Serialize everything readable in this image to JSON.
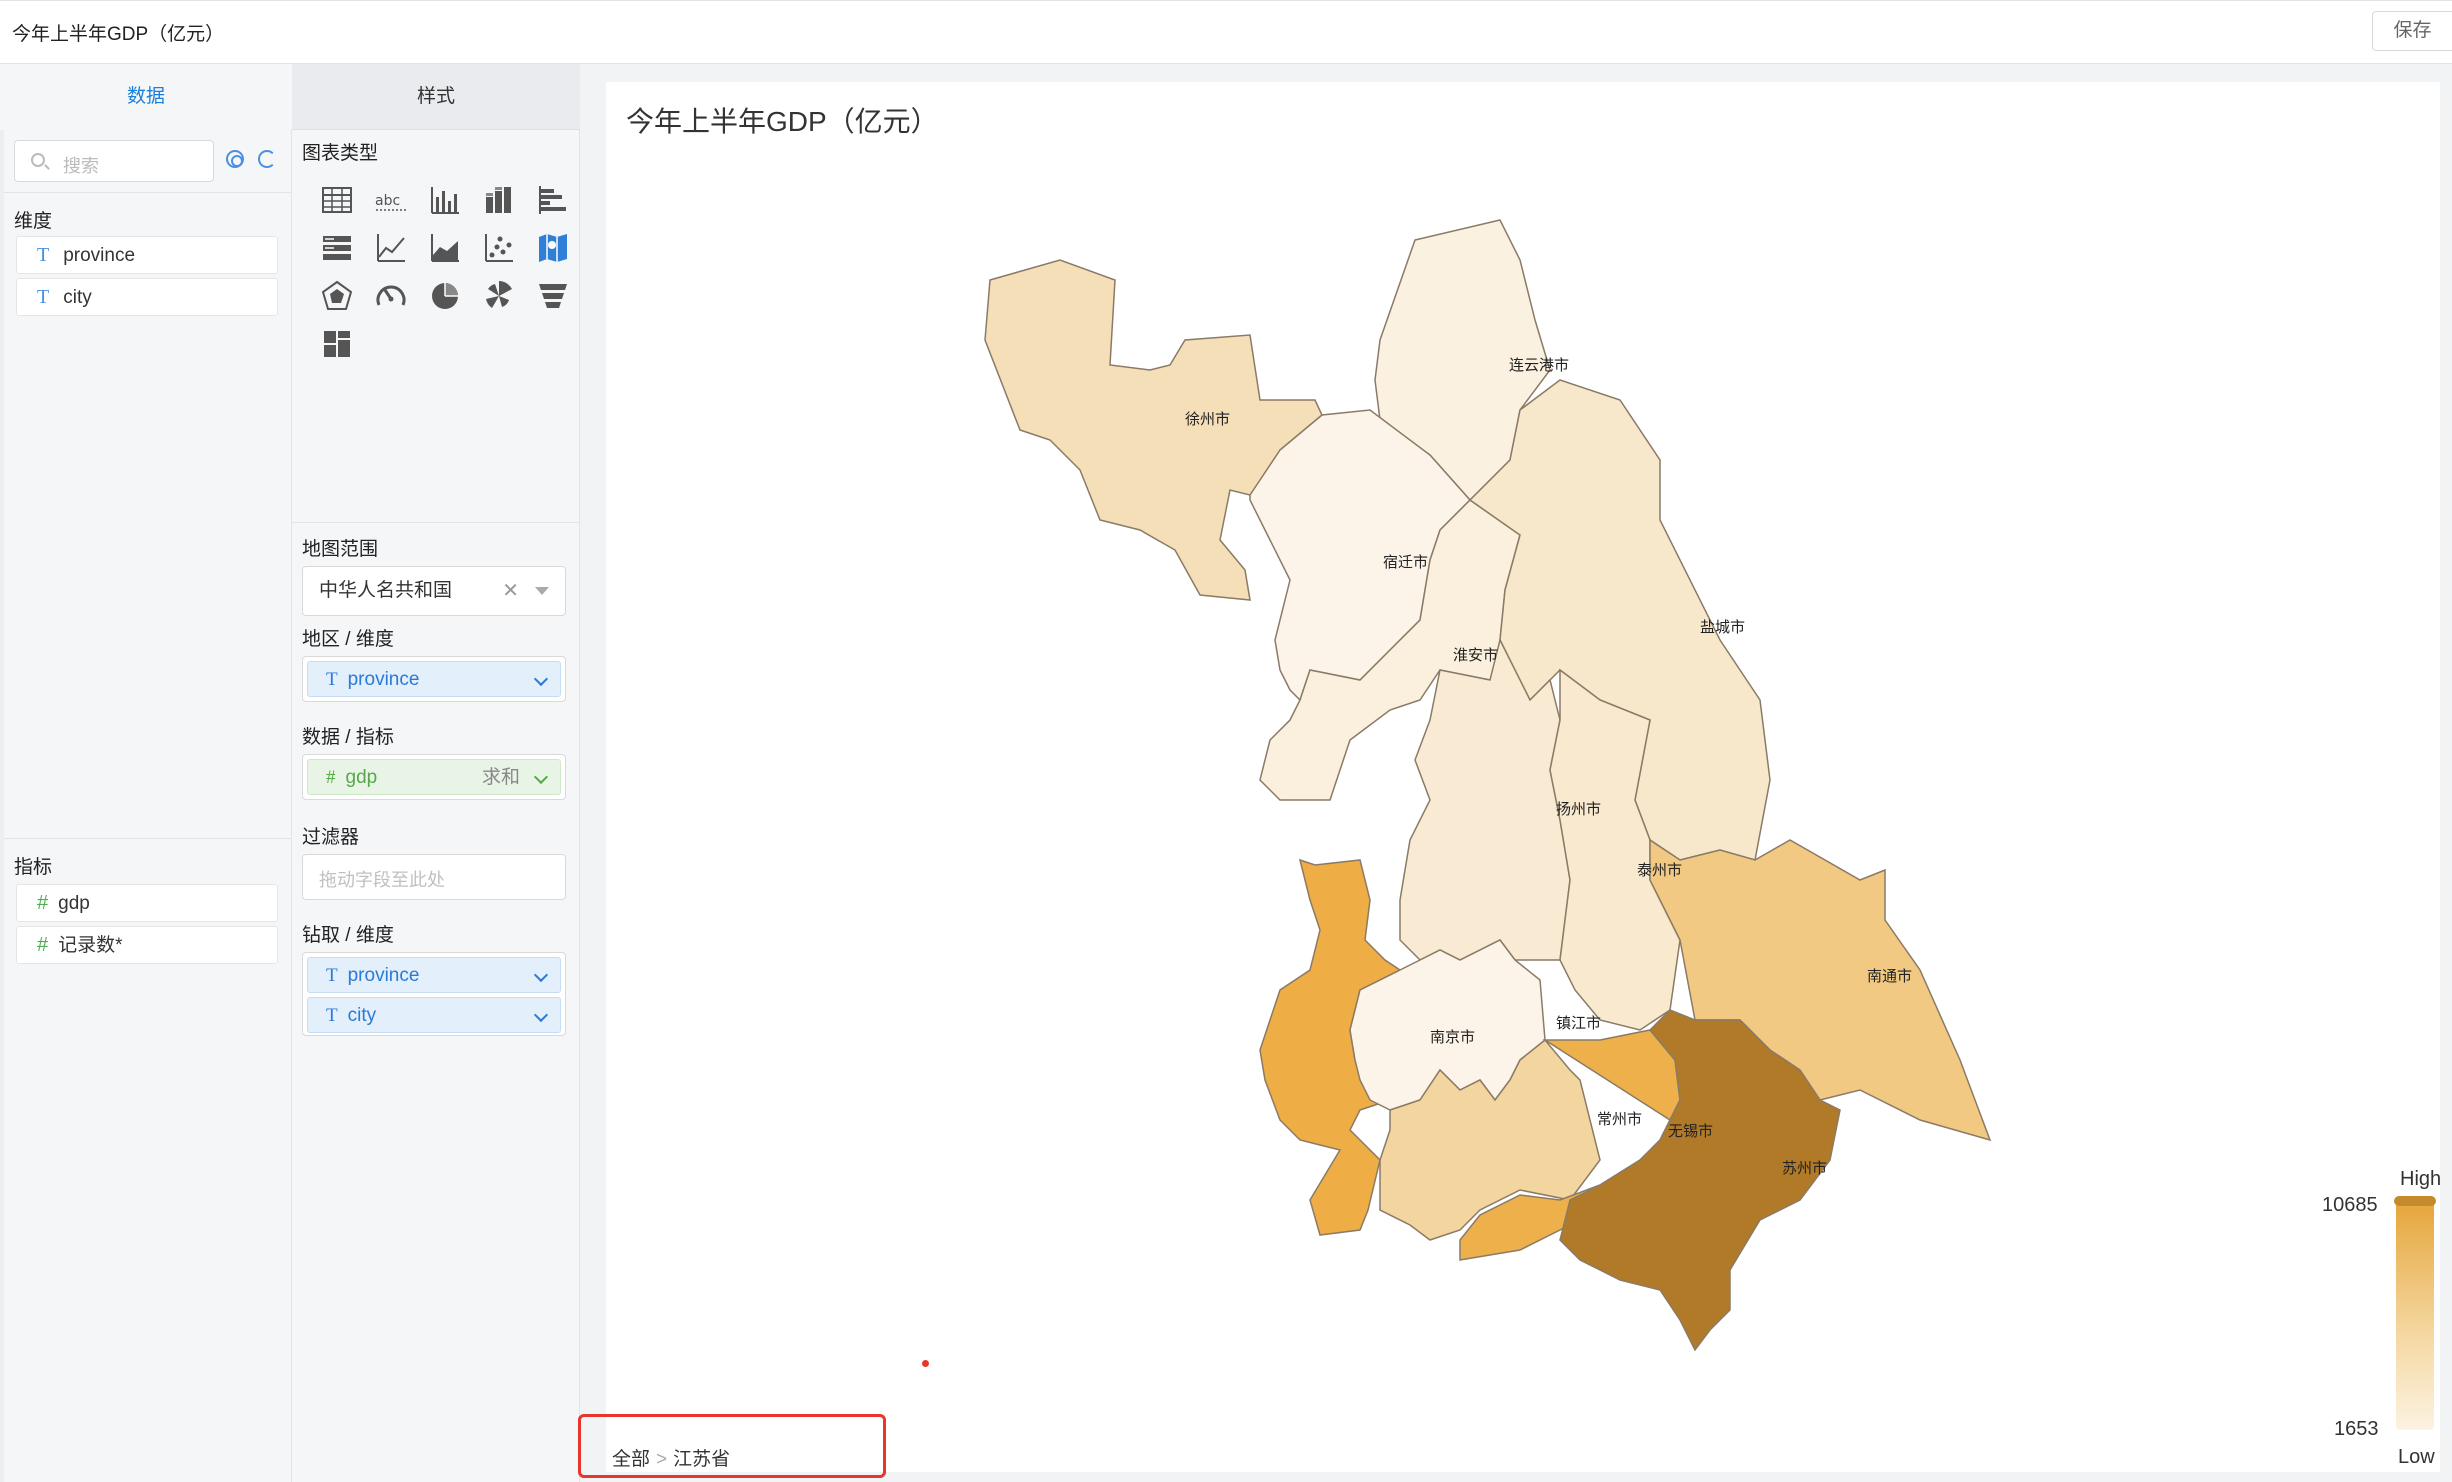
{
  "app": {
    "title": "今年上半年GDP（亿元）",
    "save_label": "保存"
  },
  "tabs": {
    "data": "数据",
    "style": "样式"
  },
  "search": {
    "placeholder": "搜索"
  },
  "dimensions": {
    "label": "维度",
    "items": [
      "province",
      "city"
    ]
  },
  "measures": {
    "label": "指标",
    "items": [
      "gdp",
      "记录数*"
    ]
  },
  "style": {
    "chart_types_label": "图表类型",
    "map_scope_label": "地图范围",
    "map_scope_value": "中华人名共和国",
    "region_label": "地区 / 维度",
    "region_value": "province",
    "metric_label": "数据 / 指标",
    "metric_value": "gdp",
    "metric_agg": "求和",
    "filter_label": "过滤器",
    "filter_placeholder": "拖动字段至此处",
    "drill_label": "钻取 / 维度",
    "drill_items": [
      "province",
      "city"
    ],
    "chart_type_icons": [
      "table-icon",
      "text-icon",
      "bar-chart-icon",
      "stacked-bar-icon",
      "horizontal-bar-icon",
      "detail-table-icon",
      "line-chart-icon",
      "area-chart-icon",
      "scatter-icon",
      "map-icon",
      "radar-icon",
      "gauge-icon",
      "pie-icon",
      "rose-icon",
      "funnel-icon",
      "dashboard-icon"
    ]
  },
  "chart": {
    "title": "今年上半年GDP（亿元）",
    "legend_high": "High",
    "legend_low": "Low",
    "legend_max": "10685",
    "legend_min": "1653",
    "color_high": "#e5a53a",
    "color_low": "#fcf2e2",
    "breadcrumb_root": "全部",
    "breadcrumb_current": "江苏省",
    "cities": [
      "连云港市",
      "徐州市",
      "宿迁市",
      "淮安市",
      "盐城市",
      "扬州市",
      "泰州市",
      "南通市",
      "南京市",
      "镇江市",
      "常州市",
      "无锡市",
      "苏州市"
    ]
  }
}
